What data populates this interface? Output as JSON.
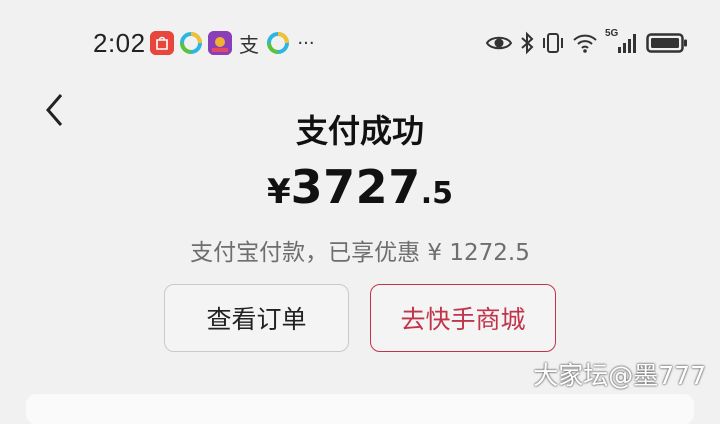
{
  "status_bar": {
    "time": "2:02",
    "app_icons": [
      "huawei-mall-icon",
      "ring-app-icon",
      "game-app-icon",
      "alipay-icon",
      "ring-app-icon"
    ],
    "alipay_glyph": "支",
    "more": "···",
    "network_label": "5G"
  },
  "page": {
    "title": "支付成功",
    "amount": {
      "currency": "¥",
      "integer": "3727",
      "decimal": ".5"
    },
    "subline": "支付宝付款，已享优惠 ¥ 1272.5"
  },
  "buttons": {
    "view_order": "查看订单",
    "go_mall": "去快手商城"
  },
  "watermark": "大家坛@墨777",
  "colors": {
    "accent": "#c0354b",
    "background": "#f1f1f1"
  }
}
